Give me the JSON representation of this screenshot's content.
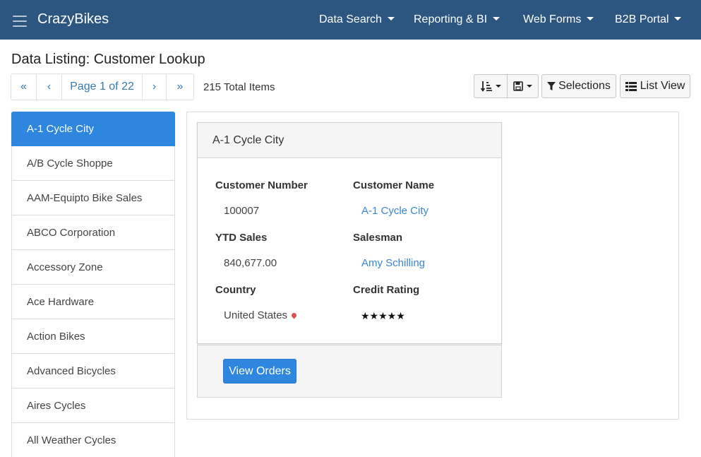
{
  "navbar": {
    "brand": "CrazyBikes",
    "menus": [
      {
        "label": "Data Search"
      },
      {
        "label": "Reporting & BI"
      },
      {
        "label": "Web Forms"
      },
      {
        "label": "B2B Portal"
      }
    ]
  },
  "page": {
    "title": "Data Listing: Customer Lookup"
  },
  "pager": {
    "first": "«",
    "prev": "‹",
    "page_label": "Page 1 of 22",
    "next": "›",
    "last": "»",
    "total_items": "215 Total Items"
  },
  "toolbar": {
    "sort_icon": "sort-icon",
    "save_icon": "save-icon",
    "selections_label": "Selections",
    "list_view_label": "List View"
  },
  "customers": [
    {
      "name": "A-1 Cycle City"
    },
    {
      "name": "A/B Cycle Shoppe"
    },
    {
      "name": "AAM-Equipto Bike Sales"
    },
    {
      "name": "ABCO Corporation"
    },
    {
      "name": "Accessory Zone"
    },
    {
      "name": "Ace Hardware"
    },
    {
      "name": "Action Bikes"
    },
    {
      "name": "Advanced Bicycles"
    },
    {
      "name": "Aires Cycles"
    },
    {
      "name": "All Weather Cycles"
    }
  ],
  "detail": {
    "header": "A-1 Cycle City",
    "fields": {
      "customer_number_label": "Customer Number",
      "customer_number": "100007",
      "customer_name_label": "Customer Name",
      "customer_name": "A-1 Cycle City",
      "ytd_sales_label": "YTD Sales",
      "ytd_sales": "840,677.00",
      "salesman_label": "Salesman",
      "salesman": "Amy Schilling",
      "country_label": "Country",
      "country": "United States",
      "credit_rating_label": "Credit Rating",
      "credit_rating": "★★★★★"
    },
    "credit_rating_value": 5,
    "view_orders_label": "View Orders"
  },
  "colors": {
    "navbar": "#2c5680",
    "accent": "#2e86de",
    "link": "#3a87d4"
  }
}
